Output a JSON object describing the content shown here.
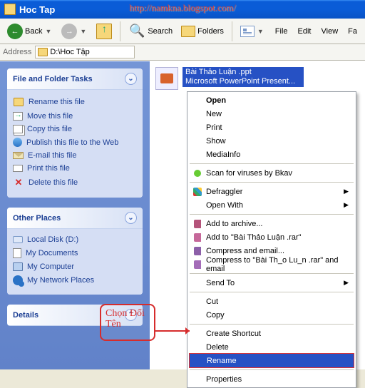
{
  "window": {
    "title": "Hoc Tap"
  },
  "watermark": "http://namkna.blogspot.com/",
  "toolbar": {
    "back": "Back",
    "search": "Search",
    "folders": "Folders"
  },
  "textmenu": {
    "file": "File",
    "edit": "Edit",
    "view": "View",
    "favorites": "Fa"
  },
  "address": {
    "label": "Address",
    "path": "D:\\Hoc Tập"
  },
  "sidebar": {
    "tasks": {
      "title": "File and Folder Tasks",
      "items": [
        "Rename this file",
        "Move this file",
        "Copy this file",
        "Publish this file to the Web",
        "E-mail this file",
        "Print this file",
        "Delete this file"
      ]
    },
    "places": {
      "title": "Other Places",
      "items": [
        "Local Disk (D:)",
        "My Documents",
        "My Computer",
        "My Network Places"
      ]
    },
    "details": {
      "title": "Details"
    }
  },
  "file": {
    "name": "Bài Thảo Luận .ppt",
    "type": "Microsoft PowerPoint Present..."
  },
  "context": {
    "open": "Open",
    "new": "New",
    "print": "Print",
    "show": "Show",
    "mediainfo": "MediaInfo",
    "scan": "Scan for viruses by Bkav",
    "defraggler": "Defraggler",
    "openwith": "Open With",
    "addarchive": "Add to archive...",
    "addrar": "Add to \"Bài Thảo Luận .rar\"",
    "compemail": "Compress and email...",
    "comprar": "Compress to \"Bài Th_o Lu_n .rar\" and email",
    "sendto": "Send To",
    "cut": "Cut",
    "copy": "Copy",
    "shortcut": "Create Shortcut",
    "delete": "Delete",
    "rename": "Rename",
    "properties": "Properties"
  },
  "callout": {
    "line1": "Chọn Đổi",
    "line2": "Tên"
  },
  "colors": {
    "selection": "#2651c4",
    "callout": "#d62c2c"
  }
}
